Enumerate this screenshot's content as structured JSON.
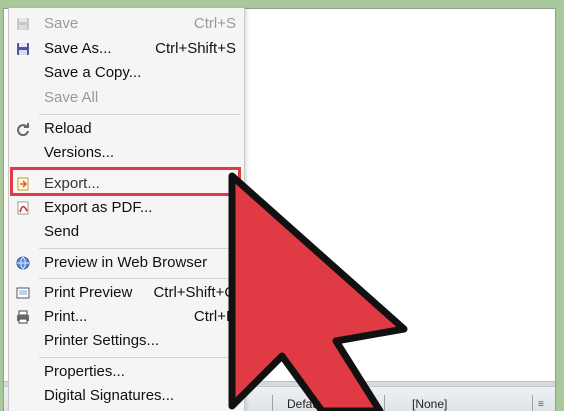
{
  "menu": {
    "items": [
      {
        "label": "Save",
        "shortcut": "Ctrl+S",
        "icon": "save-icon",
        "disabled": true
      },
      {
        "label": "Save As...",
        "shortcut": "Ctrl+Shift+S",
        "icon": "save-as-icon",
        "disabled": false
      },
      {
        "label": "Save a Copy...",
        "shortcut": "",
        "icon": "",
        "disabled": false
      },
      {
        "label": "Save All",
        "shortcut": "",
        "icon": "",
        "disabled": true
      },
      {
        "label": "Reload",
        "shortcut": "",
        "icon": "reload-icon",
        "disabled": false
      },
      {
        "label": "Versions...",
        "shortcut": "",
        "icon": "",
        "disabled": false
      },
      {
        "label": "Export...",
        "shortcut": "",
        "icon": "export-icon",
        "disabled": false
      },
      {
        "label": "Export as PDF...",
        "shortcut": "",
        "icon": "pdf-icon",
        "disabled": false
      },
      {
        "label": "Send",
        "shortcut": "",
        "icon": "",
        "disabled": false
      },
      {
        "label": "Preview in Web Browser",
        "shortcut": "",
        "icon": "web-preview-icon",
        "disabled": false
      },
      {
        "label": "Print Preview",
        "shortcut": "Ctrl+Shift+O",
        "icon": "print-preview-icon",
        "disabled": false
      },
      {
        "label": "Print...",
        "shortcut": "Ctrl+P",
        "icon": "printer-icon",
        "disabled": false
      },
      {
        "label": "Printer Settings...",
        "shortcut": "",
        "icon": "",
        "disabled": false
      },
      {
        "label": "Properties...",
        "shortcut": "",
        "icon": "",
        "disabled": false
      },
      {
        "label": "Digital Signatures...",
        "shortcut": "",
        "icon": "",
        "disabled": false
      }
    ],
    "highlighted_item": "Export..."
  },
  "status_bar": {
    "page_style": "Default Style",
    "language": "[None]"
  },
  "colors": {
    "highlight": "#e03a44",
    "arrow": "#e03a44",
    "background": "#a9c99b"
  }
}
